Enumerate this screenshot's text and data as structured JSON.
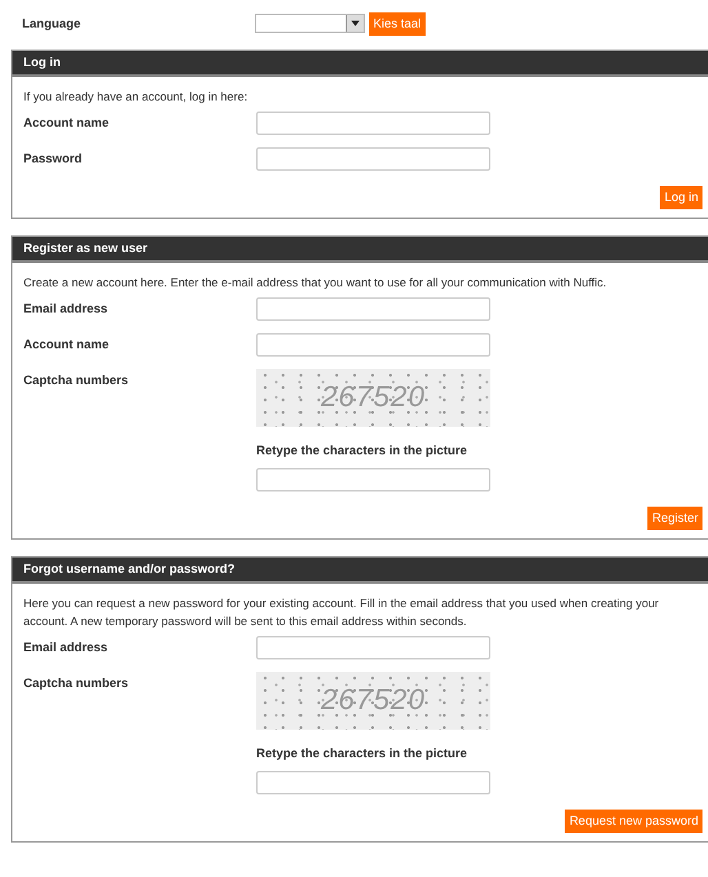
{
  "language": {
    "label": "Language",
    "button": "Kies taal"
  },
  "sections": [
    {
      "title": "Log in",
      "intro": "If you already have an account, log in here:",
      "fields": [
        {
          "kind": "input",
          "label": "Account name"
        },
        {
          "kind": "input",
          "label": "Password"
        }
      ],
      "button": "Log in"
    },
    {
      "title": "Register as new user",
      "intro": "Create a new account here. Enter the e-mail address that you want to use for all your communication with Nuffic.",
      "fields": [
        {
          "kind": "input",
          "label": "Email address"
        },
        {
          "kind": "input",
          "label": "Account name"
        },
        {
          "kind": "captcha",
          "label": "Captcha numbers",
          "code": "267520"
        },
        {
          "kind": "prompt",
          "label": "Retype the characters in the picture"
        },
        {
          "kind": "input"
        }
      ],
      "button": "Register"
    },
    {
      "title": "Forgot username and/or password?",
      "intro": "Here you can request a new password for your existing account. Fill in the email address that you used when creating your account. A new temporary password will be sent to this email address within seconds.",
      "fields": [
        {
          "kind": "input",
          "label": "Email address"
        },
        {
          "kind": "captcha",
          "label": "Captcha numbers",
          "code": "267520"
        },
        {
          "kind": "prompt",
          "label": "Retype the characters in the picture"
        },
        {
          "kind": "input"
        }
      ],
      "button": "Request new password"
    }
  ]
}
